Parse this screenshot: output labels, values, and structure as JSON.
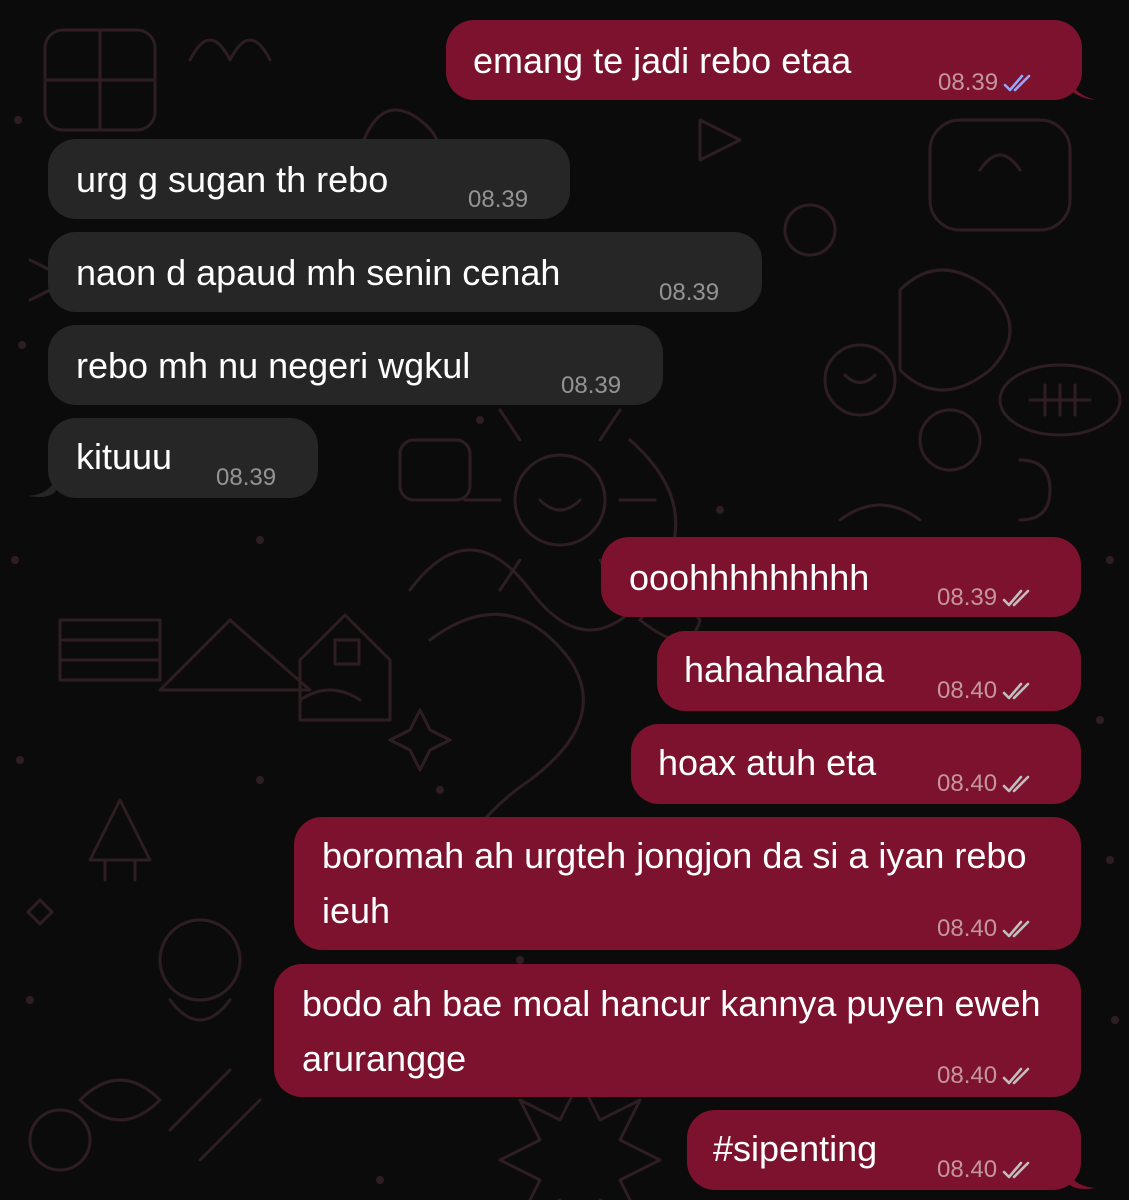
{
  "theme": {
    "outgoing_bubble": "#7c122d",
    "incoming_bubble": "#262626",
    "background": "#0c0b0b",
    "read_tick": "#8fa8ff",
    "delivered_tick": "#bfbfbf"
  },
  "messages": [
    {
      "direction": "outgoing",
      "text": "emang te jadi rebo etaa",
      "time": "08.39",
      "status": "read"
    },
    {
      "direction": "incoming",
      "text": "urg g sugan th rebo",
      "time": "08.39"
    },
    {
      "direction": "incoming",
      "text": "naon d apaud mh senin cenah",
      "time": "08.39"
    },
    {
      "direction": "incoming",
      "text": "rebo mh nu negeri wgkul",
      "time": "08.39"
    },
    {
      "direction": "incoming",
      "text": "kituuu",
      "time": "08.39"
    },
    {
      "direction": "outgoing",
      "text": "ooohhhhhhhhh",
      "time": "08.39",
      "status": "delivered"
    },
    {
      "direction": "outgoing",
      "text": "hahahahaha",
      "time": "08.40",
      "status": "delivered"
    },
    {
      "direction": "outgoing",
      "text": "hoax atuh eta",
      "time": "08.40",
      "status": "delivered"
    },
    {
      "direction": "outgoing",
      "text": "boromah ah urgteh jongjon da si a iyan rebo ieuh",
      "time": "08.40",
      "status": "delivered"
    },
    {
      "direction": "outgoing",
      "text": "bodo ah bae moal hancur kannya puyen eweh arurangge",
      "time": "08.40",
      "status": "delivered"
    },
    {
      "direction": "outgoing",
      "text": "#sipenting",
      "time": "08.40",
      "status": "delivered"
    }
  ]
}
